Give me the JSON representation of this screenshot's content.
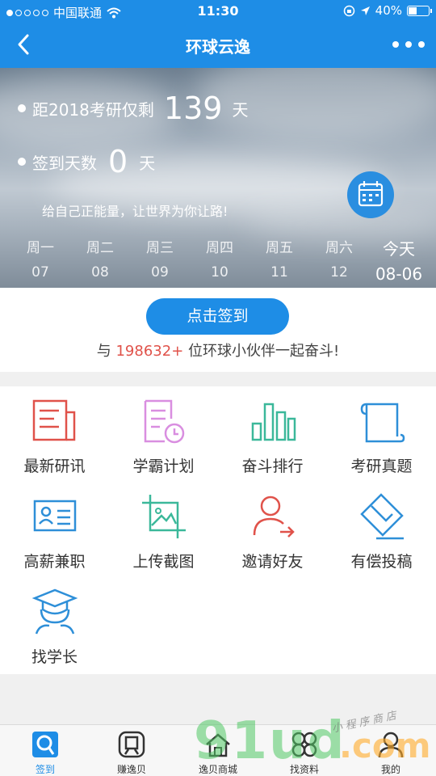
{
  "status_bar": {
    "carrier": "中国联通",
    "time": "11:30",
    "battery": "40%"
  },
  "nav": {
    "title": "环球云逸"
  },
  "hero": {
    "countdown_prefix": "距2018考研仅剩",
    "countdown_value": "139",
    "countdown_unit": "天",
    "signin_days_label": "签到天数",
    "signin_days_value": "0",
    "signin_days_unit": "天",
    "motto": "给自己正能量，让世界为你让路!",
    "week": [
      {
        "weekday": "周一",
        "date": "07"
      },
      {
        "weekday": "周二",
        "date": "08"
      },
      {
        "weekday": "周三",
        "date": "09"
      },
      {
        "weekday": "周四",
        "date": "10"
      },
      {
        "weekday": "周五",
        "date": "11"
      },
      {
        "weekday": "周六",
        "date": "12"
      },
      {
        "weekday": "今天",
        "date": "08-06"
      }
    ]
  },
  "sign": {
    "button_label": "点击签到",
    "fellow_prefix": "与",
    "fellow_count": "198632+",
    "fellow_suffix": "位环球小伙伴一起奋斗!"
  },
  "grid": [
    {
      "label": "最新研讯",
      "icon": "news-icon",
      "color": "#e0524a"
    },
    {
      "label": "学霸计划",
      "icon": "plan-icon",
      "color": "#d98ee0"
    },
    {
      "label": "奋斗排行",
      "icon": "ranking-chart-icon",
      "color": "#3bb89a"
    },
    {
      "label": "考研真题",
      "icon": "scroll-icon",
      "color": "#2e8fd8"
    },
    {
      "label": "高薪兼职",
      "icon": "id-card-icon",
      "color": "#2e8fd8"
    },
    {
      "label": "上传截图",
      "icon": "image-upload-icon",
      "color": "#3bb89a"
    },
    {
      "label": "邀请好友",
      "icon": "invite-user-icon",
      "color": "#e0524a"
    },
    {
      "label": "有偿投稿",
      "icon": "envelope-icon",
      "color": "#2e8fd8"
    },
    {
      "label": "找学长",
      "icon": "graduate-icon",
      "color": "#2e8fd8"
    }
  ],
  "tabs": [
    {
      "label": "签到",
      "icon": "signin-icon",
      "active": true
    },
    {
      "label": "赚逸贝",
      "icon": "shell-icon"
    },
    {
      "label": "逸贝商城",
      "icon": "store-icon"
    },
    {
      "label": "找资料",
      "icon": "materials-icon"
    },
    {
      "label": "我的",
      "icon": "profile-icon"
    }
  ],
  "watermark": {
    "main": "91ud",
    "domain": ".com",
    "tagline": "小程序商店"
  },
  "colors": {
    "primary": "#1e8de6",
    "highlight": "#e0524a"
  }
}
